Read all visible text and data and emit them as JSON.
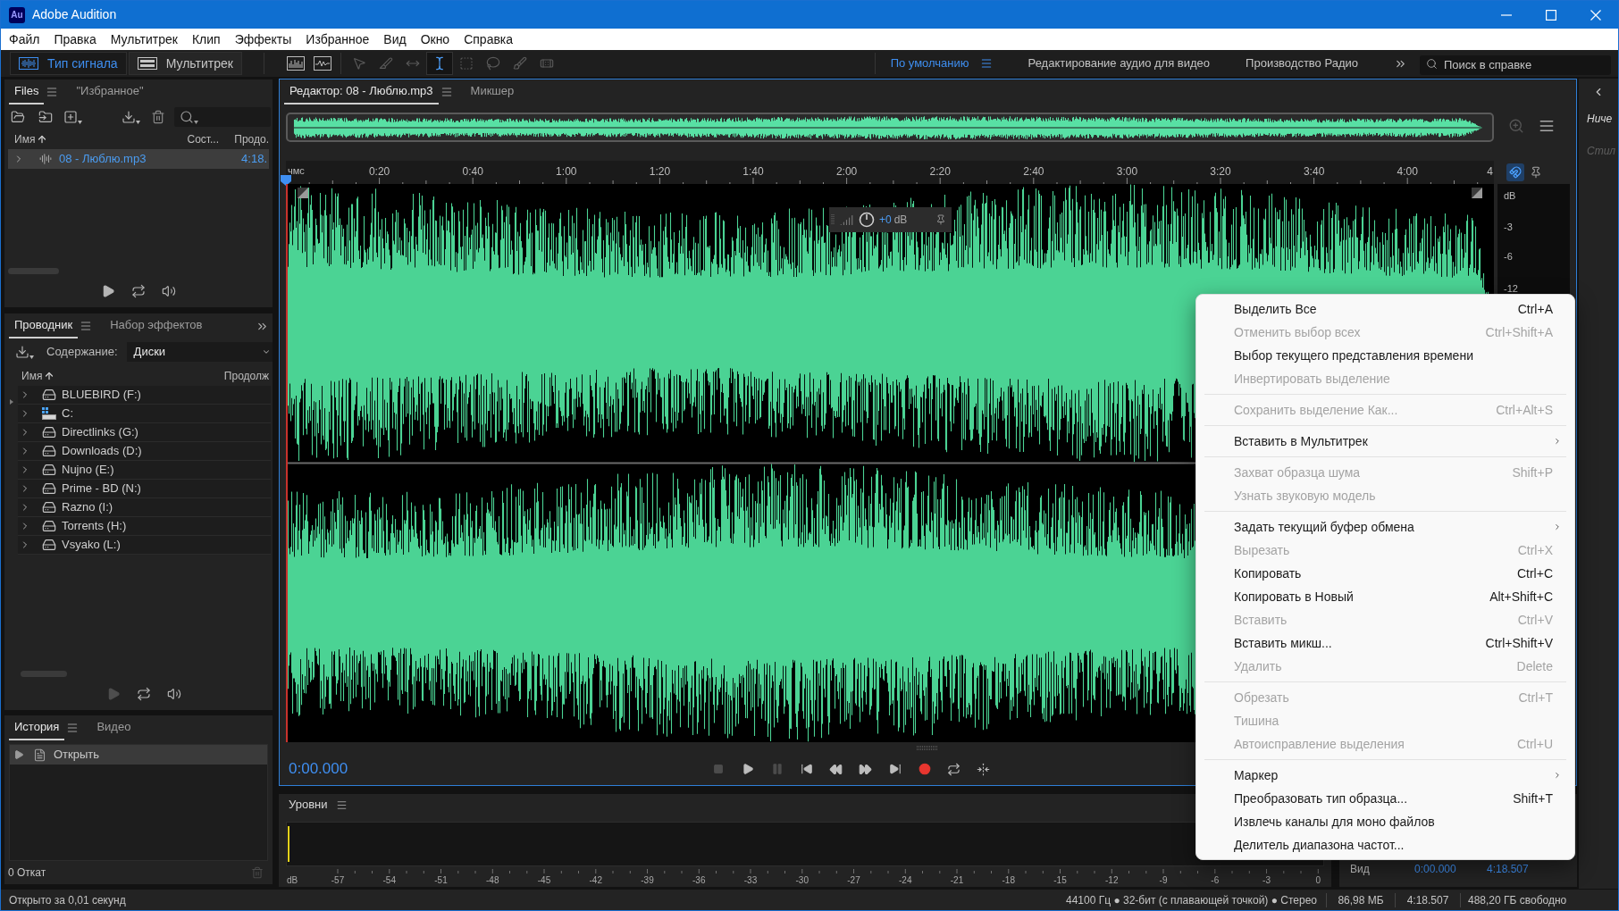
{
  "window": {
    "logo": "Au",
    "title": "Adobe Audition"
  },
  "menu_bar": [
    "Файл",
    "Правка",
    "Мультитрек",
    "Клип",
    "Эффекты",
    "Избранное",
    "Вид",
    "Окно",
    "Справка"
  ],
  "toolbar": {
    "modes": [
      {
        "kind": "waveform",
        "label": "Тип сигнала",
        "selected": true
      },
      {
        "kind": "multitrack",
        "label": "Мультитрек",
        "selected": false
      }
    ],
    "tools": [
      {
        "kind": "spectral",
        "selected": false,
        "disabled": false
      },
      {
        "kind": "pitch",
        "selected": false,
        "disabled": false
      },
      {
        "kind": "move",
        "selected": false,
        "disabled": true
      },
      {
        "kind": "razor",
        "selected": false,
        "disabled": true
      },
      {
        "kind": "slip",
        "selected": false,
        "disabled": true
      },
      {
        "kind": "time-selection",
        "selected": true,
        "disabled": false
      },
      {
        "kind": "marquee",
        "selected": false,
        "disabled": true
      },
      {
        "kind": "lasso",
        "selected": false,
        "disabled": true
      },
      {
        "kind": "brush",
        "selected": false,
        "disabled": true
      },
      {
        "kind": "healing",
        "selected": false,
        "disabled": true
      }
    ],
    "workspaces": [
      {
        "label": "По умолчанию",
        "selected": true
      },
      {
        "label": "Редактирование аудио для видео",
        "selected": false
      },
      {
        "label": "Производство Радио",
        "selected": false
      }
    ],
    "help_search": {
      "placeholder": "Поиск в справке"
    }
  },
  "files_panel": {
    "tabs": [
      {
        "label": "Files",
        "selected": true
      },
      {
        "label": "\"Избранное\"",
        "selected": false
      }
    ],
    "columns": [
      {
        "label": "Имя",
        "sorted": true
      },
      {
        "label": "Сост...",
        "sorted": false
      },
      {
        "label": "Продо.",
        "sorted": false
      }
    ],
    "rows": [
      {
        "name": "08 - Люблю.mp3",
        "duration": "4:18.",
        "selected": true,
        "expanded": false
      }
    ],
    "controls": [
      {
        "kind": "play",
        "disabled": false
      },
      {
        "kind": "loop",
        "disabled": false
      },
      {
        "kind": "autoplay",
        "disabled": false
      }
    ]
  },
  "explorer_panel": {
    "tabs": [
      {
        "label": "Проводник",
        "selected": true
      },
      {
        "label": "Набор эффектов",
        "selected": false
      }
    ],
    "content_label": "Содержание:",
    "content_value": "Диски",
    "columns": [
      {
        "label": "Имя",
        "sorted": true
      },
      {
        "label": "Продолж",
        "sorted": false
      }
    ],
    "items": [
      {
        "name": "BLUEBIRD (F:)",
        "kind": "drive",
        "expanded": false
      },
      {
        "name": "C:",
        "kind": "system-drive",
        "expanded": false
      },
      {
        "name": "Directlinks (G:)",
        "kind": "drive",
        "expanded": false
      },
      {
        "name": "Downloads (D:)",
        "kind": "drive",
        "expanded": false
      },
      {
        "name": "Nujno (E:)",
        "kind": "drive",
        "expanded": false
      },
      {
        "name": "Prime - BD (N:)",
        "kind": "drive",
        "expanded": false
      },
      {
        "name": "Razno (I:)",
        "kind": "drive",
        "expanded": false
      },
      {
        "name": "Torrents (H:)",
        "kind": "drive",
        "expanded": false
      },
      {
        "name": "Vsyako (L:)",
        "kind": "drive",
        "expanded": false
      }
    ],
    "controls": [
      {
        "kind": "play",
        "disabled": true
      },
      {
        "kind": "loop",
        "disabled": false
      },
      {
        "kind": "autoplay",
        "disabled": false
      }
    ]
  },
  "history_panel": {
    "tabs": [
      {
        "label": "История",
        "selected": true
      },
      {
        "label": "Видео",
        "selected": false
      }
    ],
    "items": [
      {
        "label": "Открыть",
        "selected": true
      }
    ],
    "footer": "0 Откат"
  },
  "editor": {
    "tabs": [
      {
        "label": "Редактор: 08 - Люблю.mp3",
        "selected": true
      },
      {
        "label": "Микшер",
        "selected": false
      }
    ],
    "ruler": {
      "unit": "чмс",
      "labels": [
        "0:20",
        "0:40",
        "1:00",
        "1:20",
        "1:40",
        "2:00",
        "2:20",
        "2:40",
        "3:00",
        "3:20",
        "3:40",
        "4:00",
        "4"
      ]
    },
    "db_scale": [
      "dB",
      "-3",
      "-6",
      "-12"
    ],
    "gain_hud": {
      "value": "+0",
      "unit": "dB"
    },
    "time": "0:00.000",
    "transport": [
      {
        "kind": "stop",
        "disabled": true
      },
      {
        "kind": "play",
        "disabled": false
      },
      {
        "kind": "pause",
        "disabled": true
      },
      {
        "kind": "to-start",
        "disabled": false
      },
      {
        "kind": "rewind",
        "disabled": false
      },
      {
        "kind": "fast-forward",
        "disabled": false
      },
      {
        "kind": "to-end",
        "disabled": false
      },
      {
        "kind": "record",
        "disabled": false
      },
      {
        "kind": "loop",
        "disabled": false
      },
      {
        "kind": "skip-selection",
        "disabled": false
      }
    ]
  },
  "levels_panel": {
    "title": "Уровни",
    "scale": [
      "dB",
      "-57",
      "-54",
      "-51",
      "-48",
      "-45",
      "-42",
      "-39",
      "-36",
      "-33",
      "-30",
      "-27",
      "-24",
      "-21",
      "-18",
      "-15",
      "-12",
      "-9",
      "-6",
      "-3",
      "0"
    ]
  },
  "selection_panel": {
    "rows": [
      {
        "label": "Вид",
        "start": "0:00.000",
        "end": "4:18.507"
      }
    ]
  },
  "side_panel": {
    "items": [
      {
        "label": "Ниче",
        "disabled": false
      },
      {
        "label": "Стил",
        "disabled": true
      }
    ]
  },
  "context_menu": {
    "groups": [
      {
        "items": [
          {
            "label": "Выделить Все",
            "shortcut": "Ctrl+A",
            "disabled": false,
            "submenu": false
          },
          {
            "label": "Отменить выбор всех",
            "shortcut": "Ctrl+Shift+A",
            "disabled": true,
            "submenu": false
          },
          {
            "label": "Выбор текущего представления времени",
            "disabled": false,
            "submenu": false
          },
          {
            "label": "Инвертировать выделение",
            "disabled": true,
            "submenu": false
          }
        ]
      },
      {
        "items": [
          {
            "label": "Сохранить выделение Как...",
            "shortcut": "Ctrl+Alt+S",
            "disabled": true,
            "submenu": false
          }
        ]
      },
      {
        "items": [
          {
            "label": "Вставить в Мультитрек",
            "disabled": false,
            "submenu": true
          }
        ]
      },
      {
        "items": [
          {
            "label": "Захват образца шума",
            "shortcut": "Shift+P",
            "disabled": true,
            "submenu": false
          },
          {
            "label": "Узнать звуковую модель",
            "disabled": true,
            "submenu": false
          }
        ]
      },
      {
        "items": [
          {
            "label": "Задать текущий буфер обмена",
            "disabled": false,
            "submenu": true
          },
          {
            "label": "Вырезать",
            "shortcut": "Ctrl+X",
            "disabled": true,
            "submenu": false
          },
          {
            "label": "Копировать",
            "shortcut": "Ctrl+C",
            "disabled": false,
            "submenu": false
          },
          {
            "label": "Копировать в Новый",
            "shortcut": "Alt+Shift+C",
            "disabled": false,
            "submenu": false
          },
          {
            "label": "Вставить",
            "shortcut": "Ctrl+V",
            "disabled": true,
            "submenu": false
          },
          {
            "label": "Вставить микш...",
            "shortcut": "Ctrl+Shift+V",
            "disabled": false,
            "submenu": false
          },
          {
            "label": "Удалить",
            "shortcut": "Delete",
            "disabled": true,
            "submenu": false
          }
        ]
      },
      {
        "items": [
          {
            "label": "Обрезать",
            "shortcut": "Ctrl+T",
            "disabled": true,
            "submenu": false
          },
          {
            "label": "Тишина",
            "disabled": true,
            "submenu": false
          },
          {
            "label": "Автоисправление выделения",
            "shortcut": "Ctrl+U",
            "disabled": true,
            "submenu": false
          }
        ]
      },
      {
        "items": [
          {
            "label": "Маркер",
            "disabled": false,
            "submenu": true
          },
          {
            "label": "Преобразовать тип образца...",
            "shortcut": "Shift+T",
            "disabled": false,
            "submenu": false
          },
          {
            "label": "Извлечь каналы для моно файлов",
            "disabled": false,
            "submenu": false
          },
          {
            "label": "Делитель диапазона частот...",
            "disabled": false,
            "submenu": false
          }
        ]
      }
    ]
  },
  "status_bar": {
    "message": "Открыто за 0,01 секунд",
    "format": "44100 Гц ● 32-бит (с плавающей точкой) ● Стерео",
    "size": "86,98 МБ",
    "duration": "4:18.507",
    "free": "488,20 ГБ свободно"
  }
}
